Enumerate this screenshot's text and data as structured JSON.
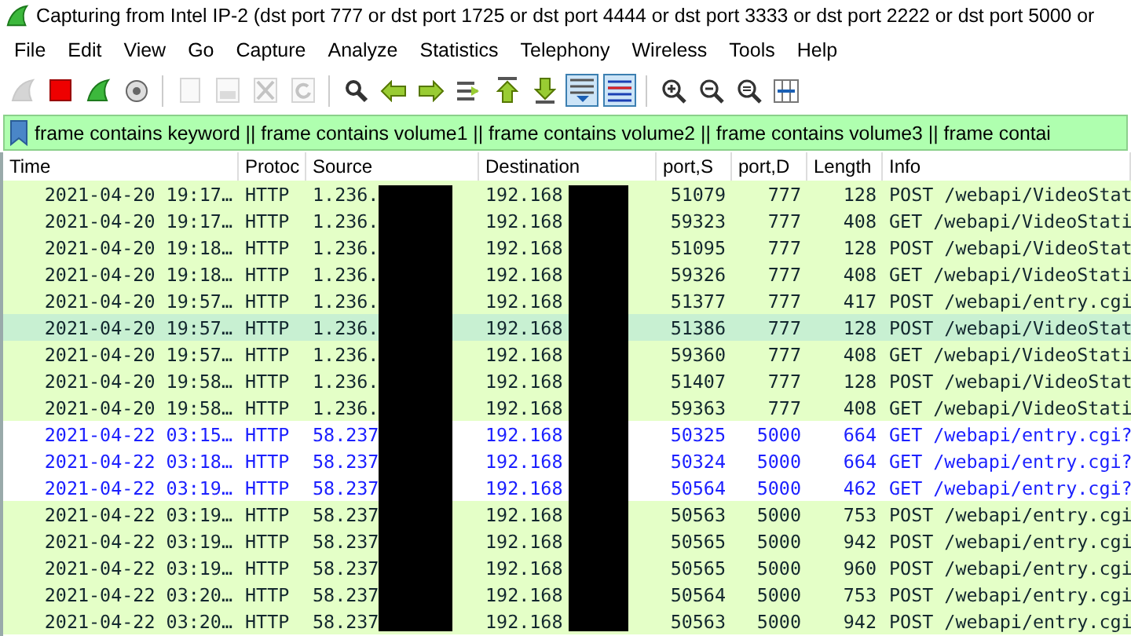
{
  "window": {
    "title": "Capturing from Intel IP-2 (dst port 777 or dst port 1725 or dst port 4444 or dst port 3333 or dst port 2222 or dst port 5000 or"
  },
  "menu": [
    "File",
    "Edit",
    "View",
    "Go",
    "Capture",
    "Analyze",
    "Statistics",
    "Telephony",
    "Wireless",
    "Tools",
    "Help"
  ],
  "toolbar": [
    [
      {
        "kind": "fin",
        "disabled": true,
        "on": false
      },
      {
        "kind": "stop",
        "disabled": false,
        "on": false
      },
      {
        "kind": "restart",
        "disabled": false,
        "on": false
      },
      {
        "kind": "gear",
        "disabled": false,
        "on": false
      }
    ],
    [
      {
        "kind": "file",
        "disabled": true,
        "on": false
      },
      {
        "kind": "save",
        "disabled": true,
        "on": false
      },
      {
        "kind": "close",
        "disabled": true,
        "on": false
      },
      {
        "kind": "reload",
        "disabled": true,
        "on": false
      }
    ],
    [
      {
        "kind": "search",
        "disabled": false,
        "on": false
      },
      {
        "kind": "back",
        "disabled": false,
        "on": false
      },
      {
        "kind": "forward",
        "disabled": false,
        "on": false
      },
      {
        "kind": "goto",
        "disabled": false,
        "on": false
      },
      {
        "kind": "first",
        "disabled": false,
        "on": false
      },
      {
        "kind": "last",
        "disabled": false,
        "on": false
      },
      {
        "kind": "autoscroll",
        "disabled": false,
        "on": true
      },
      {
        "kind": "colorize",
        "disabled": false,
        "on": true
      }
    ],
    [
      {
        "kind": "zoomin",
        "disabled": false,
        "on": false
      },
      {
        "kind": "zoomout",
        "disabled": false,
        "on": false
      },
      {
        "kind": "zoomreset",
        "disabled": false,
        "on": false
      },
      {
        "kind": "columns",
        "disabled": false,
        "on": false
      }
    ]
  ],
  "filter": {
    "value": "frame contains keyword || frame contains volume1 || frame contains volume2 || frame contains volume3 || frame contai"
  },
  "table": {
    "columns": [
      "Time",
      "Protoc",
      "Source",
      "Destination",
      "port,S",
      "port,D",
      "Length",
      "Info"
    ],
    "rows": [
      {
        "kind": "green",
        "selected": false,
        "cells": [
          "2021-04-20 19:17…",
          "HTTP",
          "1.236.",
          "192.168",
          "51079",
          "777",
          "128",
          "POST /webapi/VideoStat"
        ]
      },
      {
        "kind": "green",
        "selected": false,
        "cells": [
          "2021-04-20 19:17…",
          "HTTP",
          "1.236.",
          "192.168",
          "59323",
          "777",
          "408",
          "GET /webapi/VideoStati"
        ]
      },
      {
        "kind": "green",
        "selected": false,
        "cells": [
          "2021-04-20 19:18…",
          "HTTP",
          "1.236.",
          "192.168",
          "51095",
          "777",
          "128",
          "POST /webapi/VideoStat"
        ]
      },
      {
        "kind": "green",
        "selected": false,
        "cells": [
          "2021-04-20 19:18…",
          "HTTP",
          "1.236.",
          "192.168",
          "59326",
          "777",
          "408",
          "GET /webapi/VideoStati"
        ]
      },
      {
        "kind": "green",
        "selected": false,
        "cells": [
          "2021-04-20 19:57…",
          "HTTP",
          "1.236.",
          "192.168",
          "51377",
          "777",
          "417",
          "POST /webapi/entry.cgi"
        ]
      },
      {
        "kind": "green",
        "selected": true,
        "cells": [
          "2021-04-20 19:57…",
          "HTTP",
          "1.236.",
          "192.168",
          "51386",
          "777",
          "128",
          "POST /webapi/VideoStat"
        ]
      },
      {
        "kind": "green",
        "selected": false,
        "cells": [
          "2021-04-20 19:57…",
          "HTTP",
          "1.236.",
          "192.168",
          "59360",
          "777",
          "408",
          "GET /webapi/VideoStati"
        ]
      },
      {
        "kind": "green",
        "selected": false,
        "cells": [
          "2021-04-20 19:58…",
          "HTTP",
          "1.236.",
          "192.168",
          "51407",
          "777",
          "128",
          "POST /webapi/VideoStat"
        ]
      },
      {
        "kind": "green",
        "selected": false,
        "cells": [
          "2021-04-20 19:58…",
          "HTTP",
          "1.236.",
          "192.168",
          "59363",
          "777",
          "408",
          "GET /webapi/VideoStati"
        ]
      },
      {
        "kind": "blue",
        "selected": false,
        "cells": [
          "2021-04-22 03:15…",
          "HTTP",
          "58.237",
          "192.168",
          "50325",
          "5000",
          "664",
          "GET /webapi/entry.cgi?"
        ]
      },
      {
        "kind": "blue",
        "selected": false,
        "cells": [
          "2021-04-22 03:18…",
          "HTTP",
          "58.237",
          "192.168",
          "50324",
          "5000",
          "664",
          "GET /webapi/entry.cgi?"
        ]
      },
      {
        "kind": "blue",
        "selected": false,
        "cells": [
          "2021-04-22 03:19…",
          "HTTP",
          "58.237",
          "192.168",
          "50564",
          "5000",
          "462",
          "GET /webapi/entry.cgi?"
        ]
      },
      {
        "kind": "green",
        "selected": false,
        "cells": [
          "2021-04-22 03:19…",
          "HTTP",
          "58.237",
          "192.168",
          "50563",
          "5000",
          "753",
          "POST /webapi/entry.cgi"
        ]
      },
      {
        "kind": "green",
        "selected": false,
        "cells": [
          "2021-04-22 03:19…",
          "HTTP",
          "58.237",
          "192.168",
          "50565",
          "5000",
          "942",
          "POST /webapi/entry.cgi"
        ]
      },
      {
        "kind": "green",
        "selected": false,
        "cells": [
          "2021-04-22 03:19…",
          "HTTP",
          "58.237",
          "192.168",
          "50565",
          "5000",
          "960",
          "POST /webapi/entry.cgi"
        ]
      },
      {
        "kind": "green",
        "selected": false,
        "cells": [
          "2021-04-22 03:20…",
          "HTTP",
          "58.237",
          "192.168",
          "50564",
          "5000",
          "753",
          "POST /webapi/entry.cgi"
        ]
      },
      {
        "kind": "green",
        "selected": false,
        "cells": [
          "2021-04-22 03:20…",
          "HTTP",
          "58.237",
          "192.168",
          "50563",
          "5000",
          "942",
          "POST /webapi/entry.cgi"
        ]
      }
    ]
  }
}
